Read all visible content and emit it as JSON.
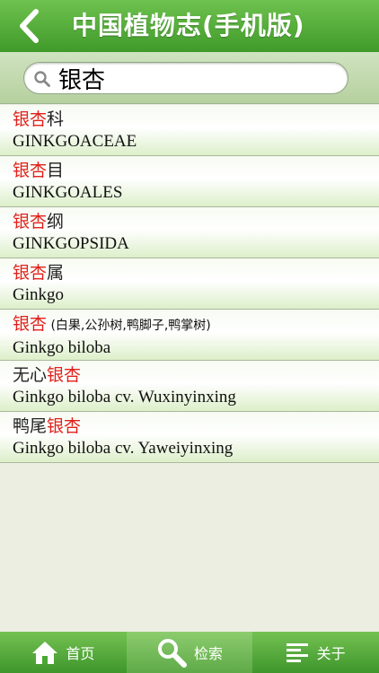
{
  "header": {
    "title": "中国植物志(手机版)"
  },
  "search": {
    "value": "银杏"
  },
  "results": [
    {
      "zh_hl": "银杏",
      "zh_rest": "科",
      "alias": "",
      "en": "GINKGOACEAE"
    },
    {
      "zh_hl": "银杏",
      "zh_rest": "目",
      "alias": "",
      "en": "GINKGOALES"
    },
    {
      "zh_hl": "银杏",
      "zh_rest": "纲",
      "alias": "",
      "en": "GINKGOPSIDA"
    },
    {
      "zh_hl": "银杏",
      "zh_rest": "属",
      "alias": "",
      "en": "Ginkgo"
    },
    {
      "zh_hl": "银杏",
      "zh_rest": "",
      "alias": " (白果,公孙树,鸭脚子,鸭掌树)",
      "en": "Ginkgo biloba"
    },
    {
      "zh_pre": "无心",
      "zh_hl": "银杏",
      "zh_rest": "",
      "alias": "",
      "en": "Ginkgo biloba cv. Wuxinyinxing"
    },
    {
      "zh_pre": "鸭尾",
      "zh_hl": "银杏",
      "zh_rest": "",
      "alias": "",
      "en": "Ginkgo biloba cv. Yaweiyinxing"
    }
  ],
  "tabs": {
    "home": "首页",
    "search": "检索",
    "about": "关于"
  },
  "colors": {
    "accent": "#4aa833",
    "highlight": "#e0211b"
  }
}
